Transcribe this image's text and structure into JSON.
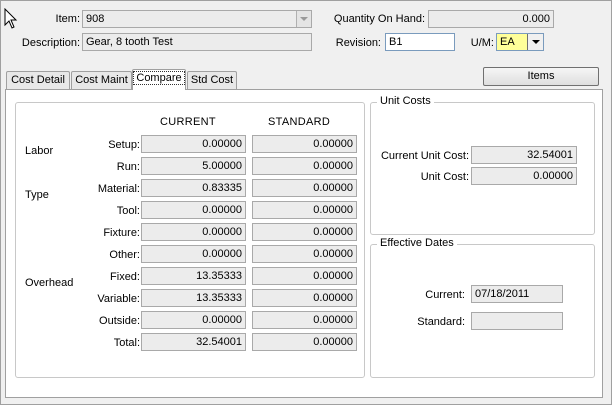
{
  "header": {
    "item_label": "Item:",
    "item_value": "908",
    "description_label": "Description:",
    "description_value": "Gear, 8 tooth Test",
    "qty_label": "Quantity On Hand:",
    "qty_value": "0.000",
    "revision_label": "Revision:",
    "revision_value": "B1",
    "um_label": "U/M:",
    "um_value": "EA"
  },
  "tabs": [
    {
      "label": "Cost Detail",
      "selected": false
    },
    {
      "label": "Cost Maint",
      "selected": false
    },
    {
      "label": "Compare",
      "selected": true
    },
    {
      "label": "Std Cost",
      "selected": false
    }
  ],
  "items_button": "Items",
  "compare": {
    "current_header": "CURRENT",
    "standard_header": "STANDARD",
    "groups": {
      "labor": "Labor",
      "type": "Type",
      "overhead": "Overhead"
    },
    "rows": [
      {
        "label": "Setup:",
        "current": "0.00000",
        "standard": "0.00000"
      },
      {
        "label": "Run:",
        "current": "5.00000",
        "standard": "0.00000"
      },
      {
        "label": "Material:",
        "current": "0.83335",
        "standard": "0.00000"
      },
      {
        "label": "Tool:",
        "current": "0.00000",
        "standard": "0.00000"
      },
      {
        "label": "Fixture:",
        "current": "0.00000",
        "standard": "0.00000"
      },
      {
        "label": "Other:",
        "current": "0.00000",
        "standard": "0.00000"
      },
      {
        "label": "Fixed:",
        "current": "13.35333",
        "standard": "0.00000"
      },
      {
        "label": "Variable:",
        "current": "13.35333",
        "standard": "0.00000"
      },
      {
        "label": "Outside:",
        "current": "0.00000",
        "standard": "0.00000"
      },
      {
        "label": "Total:",
        "current": "32.54001",
        "standard": "0.00000"
      }
    ]
  },
  "unit_costs": {
    "title": "Unit Costs",
    "current_label": "Current Unit Cost:",
    "current_value": "32.54001",
    "unit_label": "Unit Cost:",
    "unit_value": "0.00000"
  },
  "effective_dates": {
    "title": "Effective Dates",
    "current_label": "Current:",
    "current_value": "07/18/2011",
    "standard_label": "Standard:",
    "standard_value": ""
  }
}
